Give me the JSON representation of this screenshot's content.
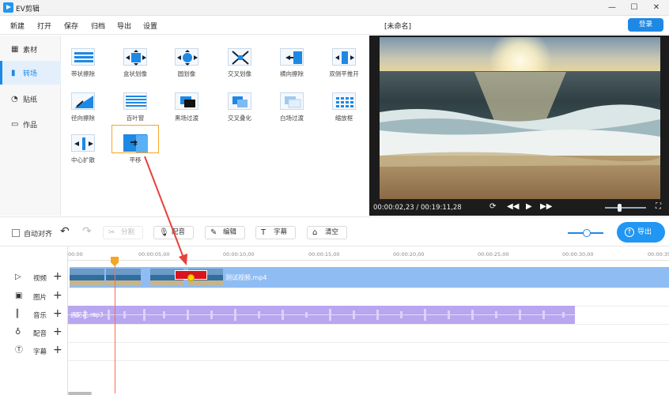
{
  "app": {
    "title": "EV剪辑",
    "project_name": "[未命名]"
  },
  "window_controls": {
    "minimize": "—",
    "maximize": "☐",
    "close": "✕"
  },
  "menu": {
    "items": [
      "新建",
      "打开",
      "保存",
      "归档",
      "导出",
      "设置"
    ],
    "login": "登录"
  },
  "sidebar": {
    "items": [
      {
        "icon": "grid-icon",
        "label": "素材"
      },
      {
        "icon": "transition-icon",
        "label": "转场",
        "active": true
      },
      {
        "icon": "sticker-icon",
        "label": "贴纸"
      },
      {
        "icon": "folder-icon",
        "label": "作品"
      }
    ]
  },
  "transitions": {
    "items": [
      "带状擦除",
      "盒状划像",
      "圆划像",
      "交叉划像",
      "横向擦除",
      "双侧平推开",
      "径向擦除",
      "百叶窗",
      "黑场过渡",
      "交叉叠化",
      "白场过渡",
      "缩放框",
      "中心扩散",
      "平移"
    ],
    "selected": "平移"
  },
  "preview": {
    "current_time": "00:00:02,23",
    "total_time": "00:19:11,28",
    "volume": 0.3
  },
  "toolbar": {
    "auto_align": "自动对齐",
    "undo": "↶",
    "redo": "↷",
    "split": "分割",
    "dub": "配音",
    "edit": "编辑",
    "subtitle": "字幕",
    "clear": "清空",
    "export": "导出",
    "zoom": 0.5
  },
  "timeline": {
    "ruler": [
      "00:00",
      "00:00:05,00",
      "00:00:10,00",
      "00:00:15,00",
      "00:00:20,00",
      "00:00:25,00",
      "00:00:30,00",
      "00:00:35"
    ],
    "tracks": [
      "视频",
      "图片",
      "音乐",
      "配音",
      "字幕"
    ],
    "video_clip": "测试视频.mp4",
    "audio_clip": "遇见花.mp3",
    "playhead_time": "00:00:02,23"
  },
  "colors": {
    "accent": "#1e88e5",
    "selection": "#f5a623",
    "annotation": "#e8403a"
  }
}
